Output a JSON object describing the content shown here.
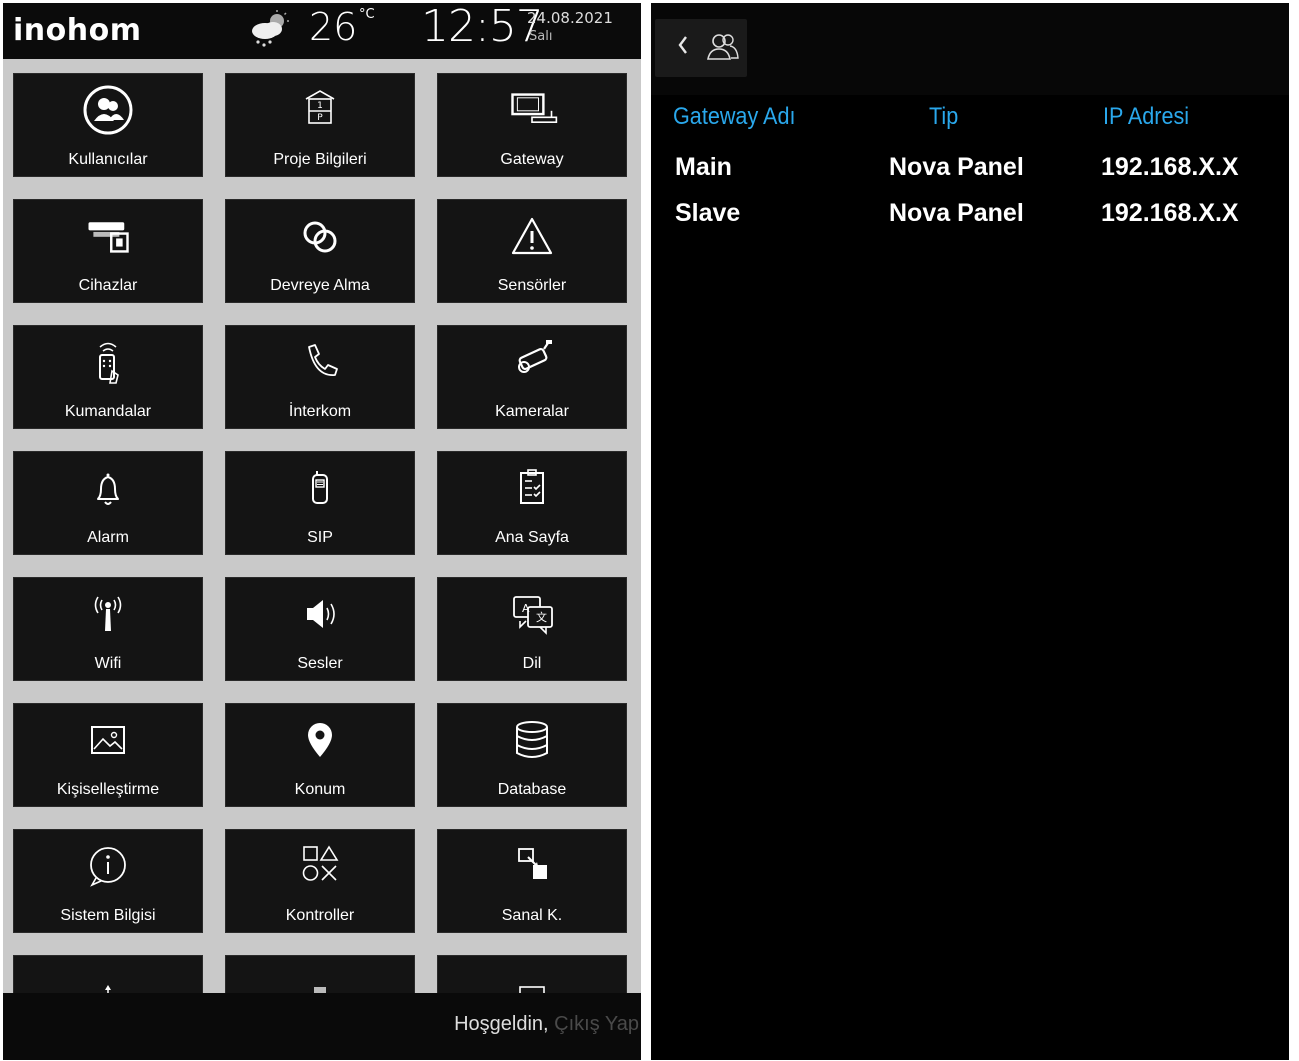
{
  "left_panel": {
    "brand": "inohom",
    "weather": {
      "icon": "partly-cloudy-rain-icon",
      "temperature": "26",
      "unit": "°C"
    },
    "clock": {
      "time": "12:57",
      "date": "24.08.2021",
      "day": "Salı"
    },
    "tiles": [
      {
        "label": "Kullanıcılar",
        "icon": "users-icon"
      },
      {
        "label": "Proje Bilgileri",
        "icon": "project-building-icon"
      },
      {
        "label": "Gateway",
        "icon": "gateway-icon"
      },
      {
        "label": "Cihazlar",
        "icon": "devices-icon"
      },
      {
        "label": "Devreye Alma",
        "icon": "commissioning-rings-icon"
      },
      {
        "label": "Sensörler",
        "icon": "warning-triangle-icon"
      },
      {
        "label": "Kumandalar",
        "icon": "remote-control-icon"
      },
      {
        "label": "İnterkom",
        "icon": "phone-icon"
      },
      {
        "label": "Kameralar",
        "icon": "security-camera-icon"
      },
      {
        "label": "Alarm",
        "icon": "bell-icon"
      },
      {
        "label": "SIP",
        "icon": "sip-handset-icon"
      },
      {
        "label": "Ana Sayfa",
        "icon": "home-checklist-icon"
      },
      {
        "label": "Wifi",
        "icon": "antenna-icon"
      },
      {
        "label": "Sesler",
        "icon": "speaker-icon"
      },
      {
        "label": "Dil",
        "icon": "language-icon"
      },
      {
        "label": "Kişiselleştirme",
        "icon": "image-icon"
      },
      {
        "label": "Konum",
        "icon": "location-pin-icon"
      },
      {
        "label": "Database",
        "icon": "database-icon"
      },
      {
        "label": "Sistem Bilgisi",
        "icon": "info-icon"
      },
      {
        "label": "Kontroller",
        "icon": "controls-shapes-icon"
      },
      {
        "label": "Sanal K.",
        "icon": "virtual-keypad-icon"
      }
    ],
    "footer": {
      "welcome": "Hoşgeldin,",
      "logout": "Çıkış Yap"
    }
  },
  "right_panel": {
    "back_icon": "chevron-left-icon",
    "users_icon": "users-outline-icon",
    "table": {
      "headers": [
        "Gateway Adı",
        "Tip",
        "IP Adresi"
      ],
      "rows": [
        [
          "Main",
          "Nova Panel",
          "192.168.X.X"
        ],
        [
          "Slave",
          "Nova Panel",
          "192.168.X.X"
        ]
      ]
    }
  },
  "colors": {
    "accent": "#2aa8ec",
    "tile_background": "#141414",
    "grid_background": "#c9c9c9",
    "panel_background": "#000000"
  }
}
